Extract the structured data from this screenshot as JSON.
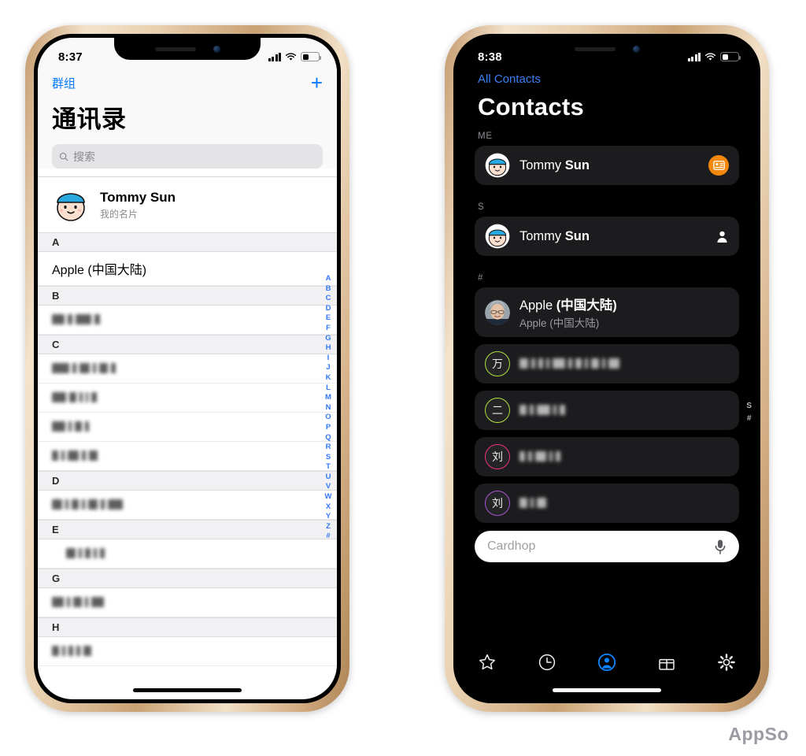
{
  "watermark": "AppSo",
  "left_phone": {
    "status": {
      "time": "8:37",
      "signal_icon": "cellular-bars-icon",
      "wifi_icon": "wifi-icon",
      "battery_icon": "battery-icon",
      "battery_level": 40
    },
    "nav": {
      "back_label": "群组",
      "add_label": "+",
      "title": "通讯录"
    },
    "search": {
      "placeholder": "搜索",
      "icon": "search-icon"
    },
    "me": {
      "name": "Tommy Sun",
      "subtitle": "我的名片",
      "avatar": "cartoon-face-avatar"
    },
    "sections": [
      {
        "letter": "A",
        "items": [
          {
            "name": "Apple (中国大陆)",
            "redacted": false
          }
        ]
      },
      {
        "letter": "B",
        "items": [
          {
            "name": "",
            "redacted": true,
            "blocks": [
              16,
              6,
              20,
              7
            ]
          }
        ]
      },
      {
        "letter": "C",
        "items": [
          {
            "name": "",
            "redacted": true,
            "blocks": [
              22,
              5,
              13,
              4,
              11,
              6
            ]
          },
          {
            "name": "",
            "redacted": true,
            "blocks": [
              18,
              9,
              4,
              3,
              7
            ]
          },
          {
            "name": "",
            "redacted": true,
            "blocks": [
              17,
              4,
              9,
              5
            ]
          },
          {
            "name": "",
            "redacted": true,
            "blocks": [
              8,
              4,
              14,
              5,
              11
            ]
          }
        ]
      },
      {
        "letter": "D",
        "items": [
          {
            "name": "",
            "redacted": true,
            "blocks": [
              13,
              4,
              9,
              4,
              12,
              5,
              19
            ]
          }
        ]
      },
      {
        "letter": "E",
        "items": [
          {
            "name": "",
            "redacted": true,
            "indent": 18,
            "blocks": [
              12,
              4,
              7,
              4,
              6
            ]
          }
        ]
      },
      {
        "letter": "G",
        "items": [
          {
            "name": "",
            "redacted": true,
            "blocks": [
              15,
              4,
              11,
              4,
              16
            ]
          }
        ]
      },
      {
        "letter": "H",
        "items": [
          {
            "name": "",
            "redacted": true,
            "blocks": [
              9,
              4,
              6,
              5,
              10
            ]
          }
        ]
      }
    ],
    "index_rail": [
      "A",
      "B",
      "C",
      "D",
      "E",
      "F",
      "G",
      "H",
      "I",
      "J",
      "K",
      "L",
      "M",
      "N",
      "O",
      "P",
      "Q",
      "R",
      "S",
      "T",
      "U",
      "V",
      "W",
      "X",
      "Y",
      "Z",
      "#"
    ],
    "accent_color": "#007aff"
  },
  "right_phone": {
    "status": {
      "time": "8:38",
      "signal_icon": "cellular-bars-icon",
      "wifi_icon": "wifi-icon",
      "battery_icon": "battery-icon",
      "battery_level": 38
    },
    "nav": {
      "back_label": "All Contacts",
      "title": "Contacts"
    },
    "sections": [
      {
        "label": "ME",
        "rows": [
          {
            "first": "Tommy ",
            "last": "Sun",
            "subtitle": "",
            "avatar_type": "cartoon-face-avatar",
            "badge": "contact-card-icon",
            "badge_color": "#f2890d"
          }
        ]
      },
      {
        "label": "S",
        "rows": [
          {
            "first": "Tommy ",
            "last": "Sun",
            "subtitle": "",
            "avatar_type": "cartoon-face-avatar",
            "badge": "person-icon",
            "badge_color": "#ffffff"
          }
        ]
      },
      {
        "label": "#",
        "rows": [
          {
            "first": "Apple ",
            "last": "(中国大陆)",
            "subtitle": "Apple (中国大陆)",
            "avatar_type": "photo-avatar",
            "badge": ""
          },
          {
            "first": "",
            "last": "",
            "redacted": true,
            "blocks": [
              11,
              5,
              6,
              4,
              16,
              5,
              8,
              4,
              10,
              4,
              14
            ],
            "avatar_type": "initial-avatar",
            "initial": "万",
            "ring_color": "#aee03c"
          },
          {
            "first": "",
            "last": "",
            "redacted": true,
            "blocks": [
              9,
              5,
              17,
              4,
              7
            ],
            "avatar_type": "initial-avatar",
            "initial": "二",
            "ring_color": "#aee03c"
          },
          {
            "first": "",
            "last": "",
            "redacted": true,
            "blocks": [
              7,
              5,
              14,
              4,
              6
            ],
            "avatar_type": "initial-avatar",
            "initial": "刘",
            "ring_color": "#f0347a"
          },
          {
            "first": "",
            "last": "",
            "redacted": true,
            "blocks": [
              10,
              4,
              12
            ],
            "avatar_type": "initial-avatar",
            "initial": "刘",
            "ring_color": "#a854d6"
          }
        ]
      }
    ],
    "search": {
      "placeholder": "Cardhop",
      "mic_icon": "microphone-icon"
    },
    "index_rail": [
      "S",
      "#"
    ],
    "tabs": [
      {
        "name": "favorites",
        "icon": "star-icon",
        "active": false
      },
      {
        "name": "recents",
        "icon": "clock-icon",
        "active": false
      },
      {
        "name": "contacts",
        "icon": "person-circle-icon",
        "active": true
      },
      {
        "name": "birthdays",
        "icon": "gift-icon",
        "active": false
      },
      {
        "name": "settings",
        "icon": "gear-icon",
        "active": false
      }
    ],
    "accent_color": "#0a84ff"
  }
}
